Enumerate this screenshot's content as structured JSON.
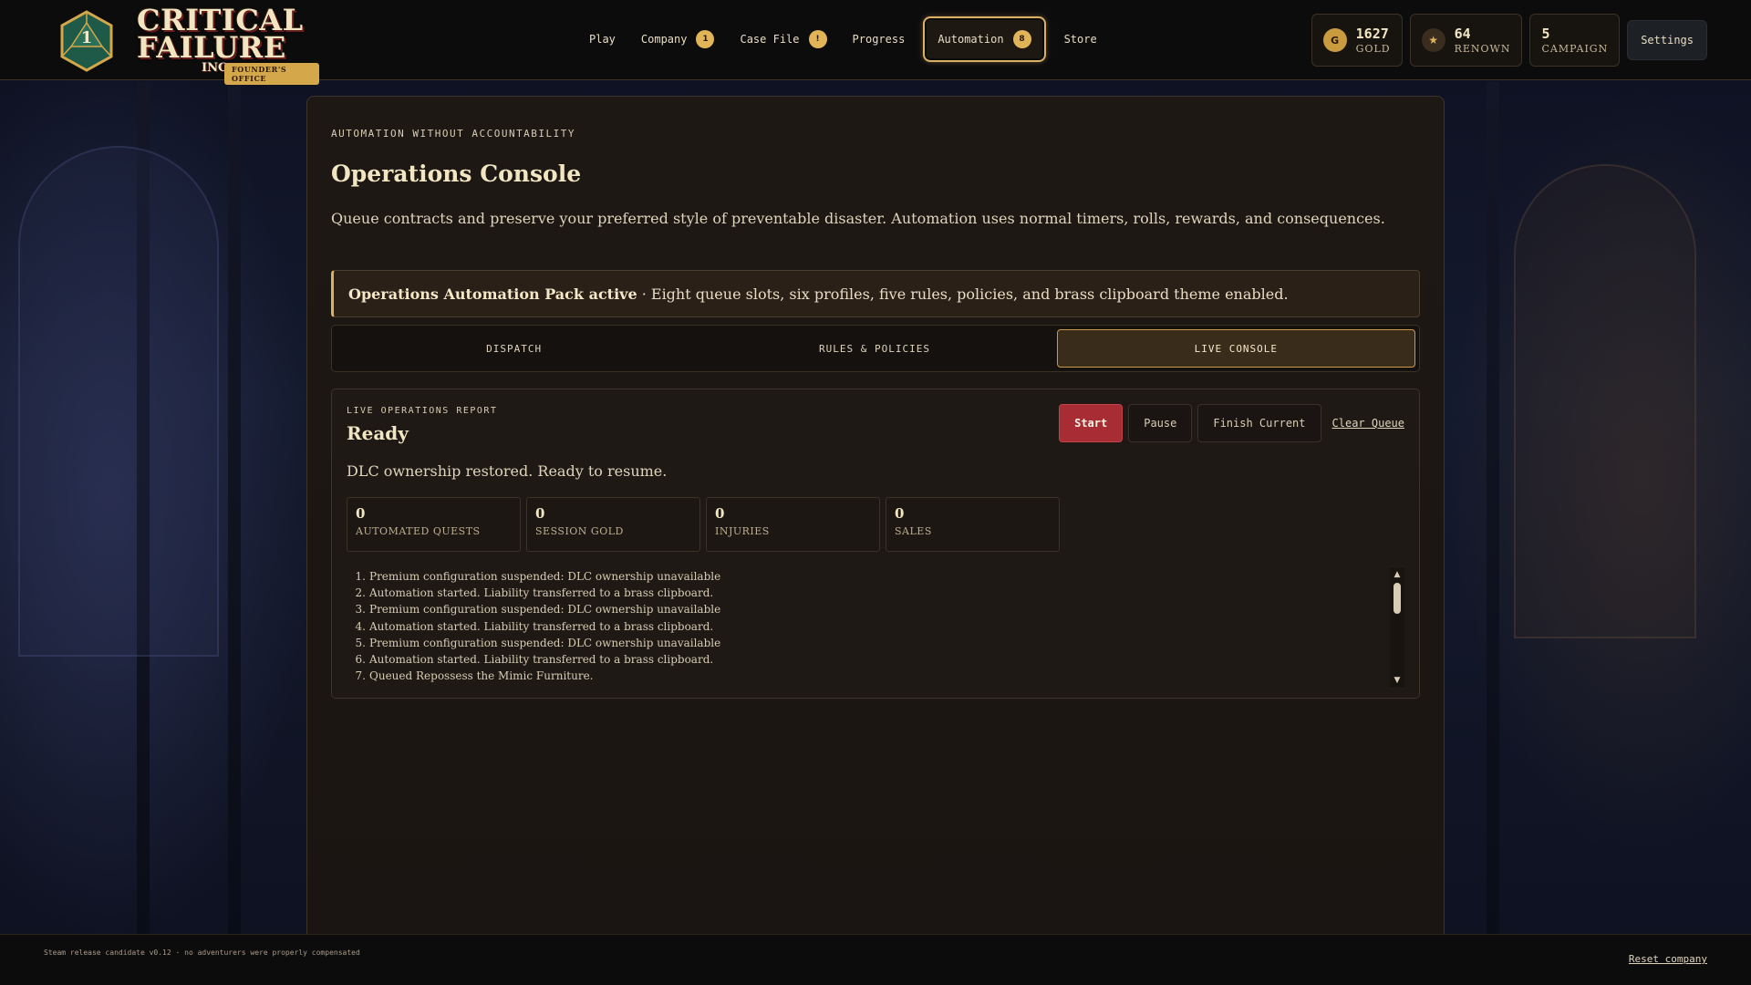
{
  "brand": {
    "title_line1": "CRITICAL",
    "title_line2": "FAILURE",
    "inc": "INC",
    "subtitle": "FOUNDER'S OFFICE",
    "die_number": "1"
  },
  "nav": {
    "items": [
      {
        "label": "Play",
        "badge": ""
      },
      {
        "label": "Company",
        "badge": "1"
      },
      {
        "label": "Case File",
        "badge": "!"
      },
      {
        "label": "Progress",
        "badge": ""
      },
      {
        "label": "Automation",
        "badge": "8"
      },
      {
        "label": "Store",
        "badge": ""
      }
    ],
    "active": "Automation"
  },
  "stats": {
    "gold": {
      "value": "1627",
      "label": "GOLD",
      "icon": "G"
    },
    "renown": {
      "value": "64",
      "label": "RENOWN",
      "icon": "★"
    },
    "campaign": {
      "value": "5",
      "label": "CAMPAIGN"
    },
    "settings_label": "Settings"
  },
  "page": {
    "eyebrow": "AUTOMATION WITHOUT ACCOUNTABILITY",
    "title": "Operations Console",
    "description": "Queue contracts and preserve your preferred style of preventable disaster. Automation uses normal timers, rolls, rewards, and consequences."
  },
  "banner": {
    "strong": "Operations Automation Pack active",
    "text": " · Eight queue slots, six profiles, five rules, policies, and brass clipboard theme enabled."
  },
  "tabs": [
    {
      "label": "DISPATCH"
    },
    {
      "label": "RULES & POLICIES"
    },
    {
      "label": "LIVE CONSOLE"
    }
  ],
  "console": {
    "eyebrow": "LIVE OPERATIONS REPORT",
    "status": "Ready",
    "message": "DLC ownership restored. Ready to resume.",
    "buttons": {
      "start": "Start",
      "pause": "Pause",
      "finish": "Finish Current",
      "clear": "Clear Queue"
    },
    "metrics": [
      {
        "value": "0",
        "label": "AUTOMATED QUESTS"
      },
      {
        "value": "0",
        "label": "SESSION GOLD"
      },
      {
        "value": "0",
        "label": "INJURIES"
      },
      {
        "value": "0",
        "label": "SALES"
      }
    ],
    "log": [
      {
        "n": "1.",
        "text": "Premium configuration suspended: DLC ownership unavailable"
      },
      {
        "n": "2.",
        "text": "Automation started. Liability transferred to a brass clipboard."
      },
      {
        "n": "3.",
        "text": "Premium configuration suspended: DLC ownership unavailable"
      },
      {
        "n": "4.",
        "text": "Automation started. Liability transferred to a brass clipboard."
      },
      {
        "n": "5.",
        "text": "Premium configuration suspended: DLC ownership unavailable"
      },
      {
        "n": "6.",
        "text": "Automation started. Liability transferred to a brass clipboard."
      },
      {
        "n": "7.",
        "text": "Queued Repossess the Mimic Furniture."
      }
    ]
  },
  "footer": {
    "note": "Steam release candidate v0.12 · no adventurers were properly compensated",
    "reset": "Reset company"
  },
  "colors": {
    "accent_gold": "#d9b064",
    "start_red": "#a82c34",
    "panel_bg": "#1b1613",
    "header_bg": "#0d0c0d"
  }
}
